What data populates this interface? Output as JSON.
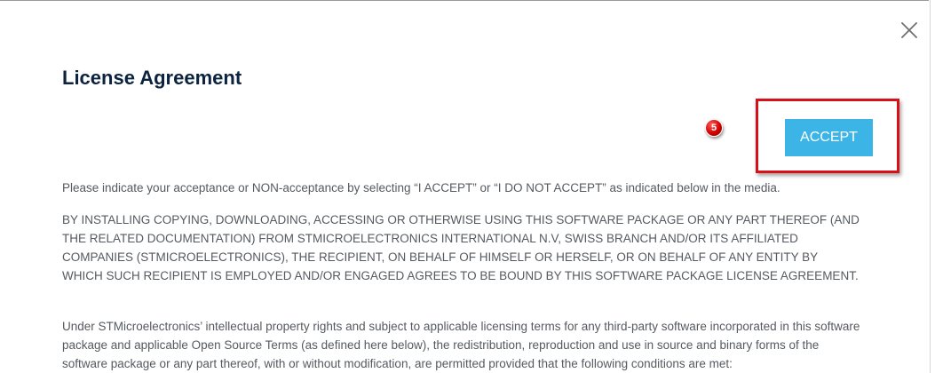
{
  "dialog": {
    "title": "License Agreement",
    "close_icon": "close-icon",
    "accept_button_label": "ACCEPT",
    "step_badge_number": "5",
    "highlight_color": "#d8101a",
    "accent_color": "#3cb4e6",
    "title_color": "#0c2340"
  },
  "body": {
    "paragraphs": [
      "Please indicate your acceptance or NON-acceptance by selecting “I ACCEPT” or “I DO NOT ACCEPT” as indicated below in the media.",
      "BY INSTALLING COPYING, DOWNLOADING, ACCESSING OR OTHERWISE USING THIS SOFTWARE PACKAGE OR ANY PART THEREOF (AND THE RELATED DOCUMENTATION) FROM STMICROELECTRONICS INTERNATIONAL N.V, SWISS BRANCH AND/OR ITS AFFILIATED COMPANIES (STMICROELECTRONICS), THE RECIPIENT, ON BEHALF OF HIMSELF OR HERSELF, OR ON BEHALF OF ANY ENTITY BY WHICH SUCH RECIPIENT IS EMPLOYED AND/OR ENGAGED AGREES TO BE BOUND BY THIS SOFTWARE PACKAGE LICENSE AGREEMENT.",
      "Under STMicroelectronics’ intellectual property rights and subject to applicable licensing terms for any third-party software incorporated in this software package and applicable Open Source Terms (as defined here below), the redistribution, reproduction and use in source and binary forms of the software package or any part thereof, with or without modification, are permitted provided that the following conditions are met:"
    ]
  }
}
